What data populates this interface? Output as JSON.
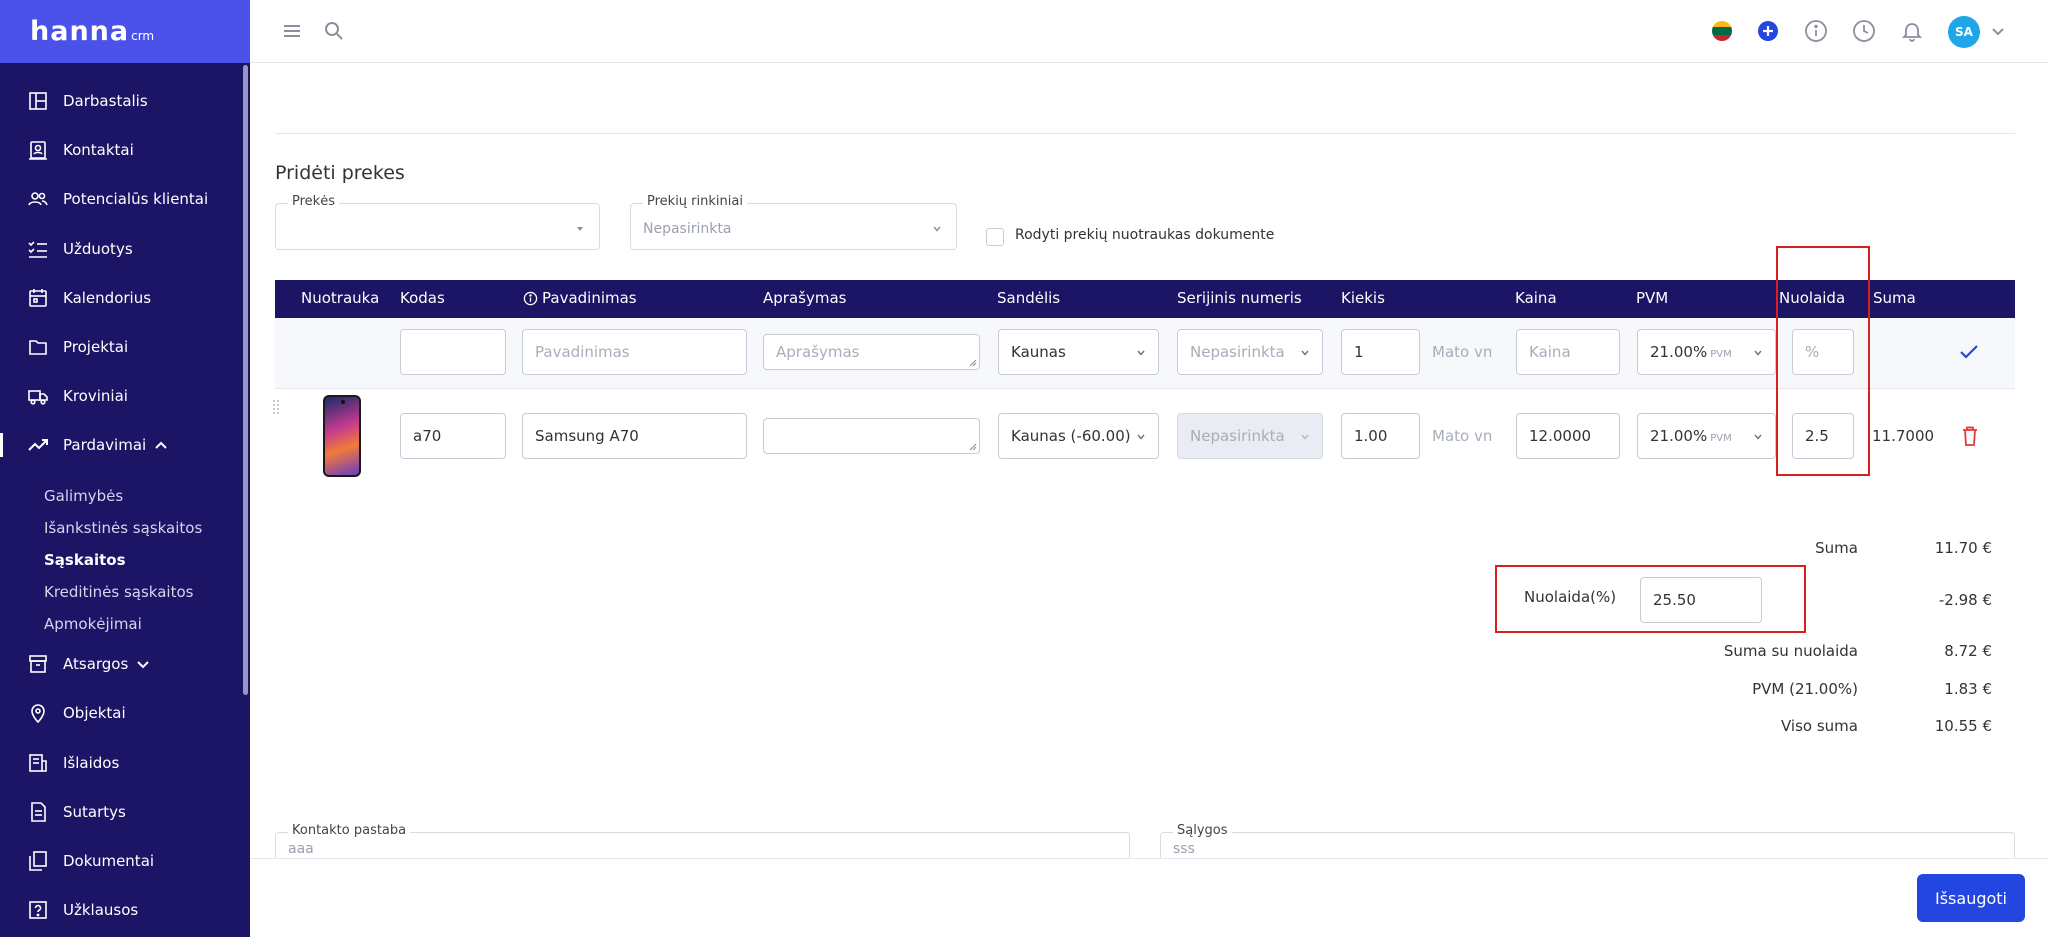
{
  "brand": {
    "name": "hanna",
    "sub": "crm"
  },
  "sidebar": {
    "items": [
      {
        "label": "Darbastalis",
        "icon": "dashboard-icon"
      },
      {
        "label": "Kontaktai",
        "icon": "contacts-icon"
      },
      {
        "label": "Potencialūs klientai",
        "icon": "leads-icon"
      },
      {
        "label": "Užduotys",
        "icon": "tasks-icon"
      },
      {
        "label": "Kalendorius",
        "icon": "calendar-icon"
      },
      {
        "label": "Projektai",
        "icon": "folder-icon"
      },
      {
        "label": "Kroviniai",
        "icon": "truck-icon"
      },
      {
        "label": "Pardavimai",
        "icon": "trend-icon"
      },
      {
        "label": "Atsargos",
        "icon": "archive-icon"
      },
      {
        "label": "Objektai",
        "icon": "location-icon"
      },
      {
        "label": "Išlaidos",
        "icon": "receipt-icon"
      },
      {
        "label": "Sutartys",
        "icon": "contract-icon"
      },
      {
        "label": "Dokumentai",
        "icon": "documents-icon"
      },
      {
        "label": "Užklausos",
        "icon": "question-icon"
      }
    ],
    "sales_sub": [
      {
        "label": "Galimybės"
      },
      {
        "label": "Išankstinės sąskaitos"
      },
      {
        "label": "Sąskaitos"
      },
      {
        "label": "Kreditinės sąskaitos"
      },
      {
        "label": "Apmokėjimai"
      }
    ]
  },
  "topbar": {
    "avatar": "SA"
  },
  "products": {
    "title": "Pridėti prekes",
    "product_select": {
      "label": "Prekės",
      "value": ""
    },
    "set_select": {
      "label": "Prekių rinkiniai",
      "value": "Nepasirinkta"
    },
    "show_photos_label": "Rodyti prekių nuotraukas dokumente"
  },
  "table": {
    "headers": {
      "photo": "Nuotrauka",
      "code": "Kodas",
      "name": "Pavadinimas",
      "description": "Aprašymas",
      "warehouse": "Sandėlis",
      "serial": "Serijinis numeris",
      "quantity": "Kiekis",
      "price": "Kaina",
      "vat": "PVM",
      "discount": "Nuolaida",
      "sum": "Suma"
    },
    "new_row": {
      "code": "",
      "name_placeholder": "Pavadinimas",
      "description_placeholder": "Aprašymas",
      "warehouse": "Kaunas",
      "serial": "Nepasirinkta",
      "quantity": "1",
      "unit": "Mato vn",
      "price_placeholder": "Kaina",
      "vat": "21.00%",
      "vat_small": "PVM",
      "discount_placeholder": "%"
    },
    "rows": [
      {
        "code": "a70",
        "name": "Samsung A70",
        "description": "",
        "warehouse": "Kaunas (-60.00)",
        "serial": "Nepasirinkta",
        "quantity": "1.00",
        "unit": "Mato vn",
        "price": "12.0000",
        "vat": "21.00%",
        "vat_small": "PVM",
        "discount": "2.5",
        "sum": "11.7000"
      }
    ]
  },
  "totals": {
    "sum_label": "Suma",
    "sum_value": "11.70 €",
    "discount_label": "Nuolaida(%)",
    "discount_input": "25.50",
    "discount_value": "-2.98 €",
    "sum_with_discount_label": "Suma su nuolaida",
    "sum_with_discount_value": "8.72 €",
    "vat_label": "PVM (21.00%)",
    "vat_value": "1.83 €",
    "total_label": "Viso suma",
    "total_value": "10.55 €"
  },
  "notes": {
    "contact_note_label": "Kontakto pastaba",
    "contact_note_value": "aaa",
    "conditions_label": "Sąlygos",
    "conditions_value": "sss"
  },
  "save_label": "Išsaugoti"
}
